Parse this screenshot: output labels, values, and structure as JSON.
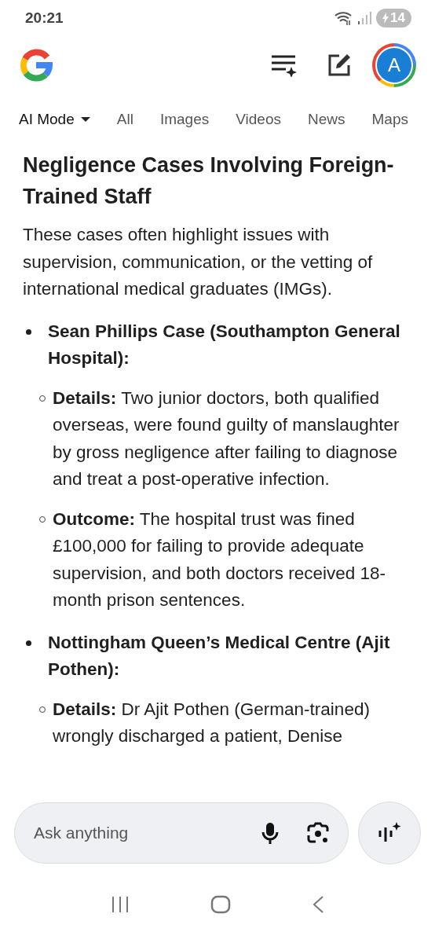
{
  "status_bar": {
    "time": "20:21",
    "battery": "14"
  },
  "header": {
    "avatar_letter": "A"
  },
  "tabs": [
    {
      "label": "AI Mode",
      "selected": true,
      "kind": "dropdown"
    },
    {
      "label": "All",
      "selected": false,
      "kind": "plain"
    },
    {
      "label": "Images",
      "selected": false,
      "kind": "plain"
    },
    {
      "label": "Videos",
      "selected": false,
      "kind": "plain"
    },
    {
      "label": "News",
      "selected": false,
      "kind": "plain"
    },
    {
      "label": "Maps",
      "selected": false,
      "kind": "plain"
    }
  ],
  "article": {
    "title": "Negligence Cases Involving Foreign-Trained Staff",
    "intro": "These cases often highlight issues with supervision, communication, or the vetting of international medical graduates (IMGs).",
    "items": [
      {
        "title": "Sean Phillips Case (Southampton General Hospital):",
        "children": [
          {
            "text": "**Details:** Two junior doctors, both qualified overseas, were found guilty of manslaughter by gross negligence after failing to diagnose and treat a post-operative infection."
          },
          {
            "text": "**Outcome:** The hospital trust was fined £100,000 for failing to provide adequate supervision, and both doctors received 18-month prison sentences."
          }
        ]
      },
      {
        "title": "Nottingham Queen’s Medical Centre (Ajit Pothen):",
        "children": [
          {
            "text": "**Details:** Dr Ajit Pothen (German-trained) wrongly discharged a patient, Denise"
          }
        ]
      }
    ]
  },
  "search": {
    "placeholder": "Ask anything"
  }
}
